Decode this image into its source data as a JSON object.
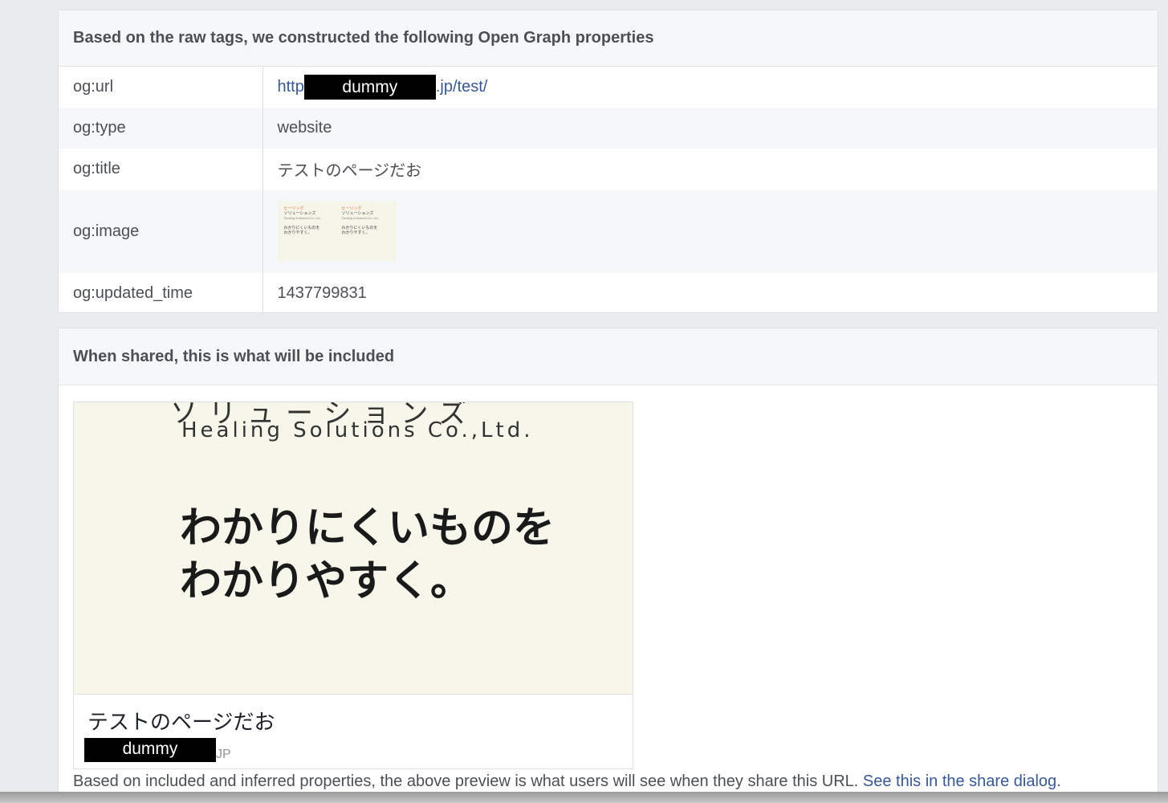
{
  "og_panel": {
    "header": "Based on the raw tags, we constructed the following Open Graph properties",
    "rows": [
      {
        "key": "og:url",
        "value_prefix": "http",
        "redaction": "dummy",
        "value_suffix": ".jp/test/"
      },
      {
        "key": "og:type",
        "value": "website"
      },
      {
        "key": "og:title",
        "value": "テストのページだお"
      },
      {
        "key": "og:image"
      },
      {
        "key": "og:updated_time",
        "value": "1437799831"
      }
    ],
    "thumbnail": {
      "logo_text": "ヒーリング",
      "company_jp": "ソリューションズ",
      "company_en": "Healing Solutions Co.,Ltd.",
      "line1": "わかりにくいものを",
      "line2": "わかりやすく。"
    }
  },
  "share_panel": {
    "header": "When shared, this is what will be included",
    "image": {
      "cut_text": "ソリューションズ",
      "company_en": "Healing Solutions Co.,Ltd.",
      "tagline_1": "わかりにくいものを",
      "tagline_2": "わかりやすく。"
    },
    "title": "テストのページだお",
    "domain_redaction": "dummy",
    "domain_suffix": "JP",
    "footnote": "Based on included and inferred properties, the above preview is what users will see when they share this URL.",
    "share_link": "See this in the share dialog."
  },
  "colors": {
    "background": "#e9ebee",
    "link": "#365899",
    "text": "#4b4f56"
  }
}
